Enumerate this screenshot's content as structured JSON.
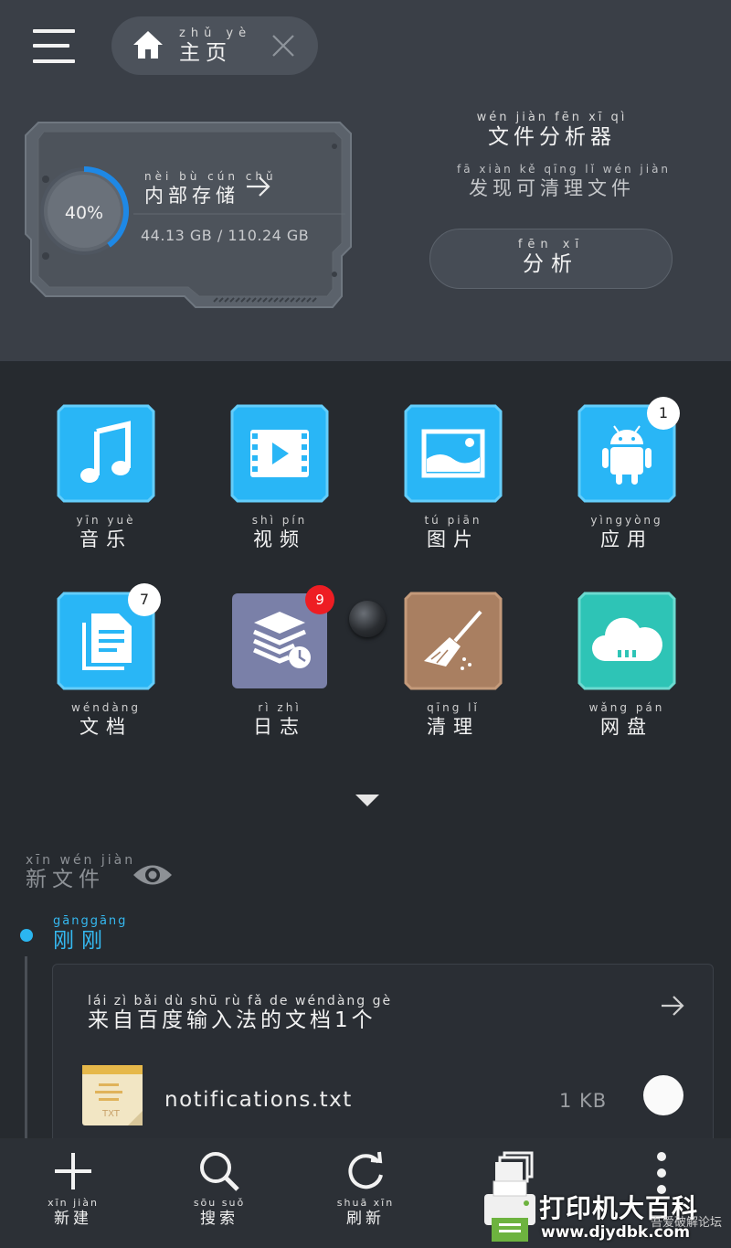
{
  "header": {
    "home_tab": {
      "pinyin": "zhǔ yè",
      "label": "主页"
    }
  },
  "storage": {
    "percent_text": "40%",
    "used_fraction": 0.4,
    "title_pinyin": "nèi bù cún chǔ",
    "title": "内部存储",
    "size_text": "44.13 GB / 110.24 GB"
  },
  "analyzer": {
    "title_pinyin": "wén jiàn fēn xī qì",
    "title": "文件分析器",
    "subtitle_pinyin": "fā xiàn kě qīng lǐ wén jiàn",
    "subtitle": "发现可清理文件",
    "button_pinyin": "fēn xī",
    "button_label": "分析"
  },
  "categories": [
    {
      "pinyin": "yīn yuè",
      "label": "音乐",
      "icon": "music-icon"
    },
    {
      "pinyin": "shì pín",
      "label": "视频",
      "icon": "video-icon"
    },
    {
      "pinyin": "tú piān",
      "label": "图片",
      "icon": "image-icon"
    },
    {
      "pinyin": "yìngyòng",
      "label": "应用",
      "icon": "android-icon",
      "badge": "1"
    },
    {
      "pinyin": "wéndàng",
      "label": "文档",
      "icon": "document-icon",
      "badge": "7"
    },
    {
      "pinyin": "rì zhì",
      "label": "日志",
      "icon": "log-icon",
      "badge": "9"
    },
    {
      "pinyin": "qīng lǐ",
      "label": "清理",
      "icon": "broom-icon"
    },
    {
      "pinyin": "wǎng pán",
      "label": "网盘",
      "icon": "cloud-icon"
    }
  ],
  "new_files": {
    "pinyin": "xīn wén jiàn",
    "label": "新文件",
    "timeline_pinyin": "gānggāng",
    "timeline_label": "刚刚",
    "group_pinyin": "lái zì bǎi dù shū rù fǎ de wéndàng gè",
    "group_title": "来自百度输入法的文档1个",
    "files": [
      {
        "name": "notifications.txt",
        "size": "1 KB",
        "icon_text": "TXT"
      }
    ]
  },
  "bottom_bar": [
    {
      "pinyin": "xīn jiàn",
      "label": "新建",
      "icon": "plus-icon"
    },
    {
      "pinyin": "sōu suǒ",
      "label": "搜索",
      "icon": "search-icon"
    },
    {
      "pinyin": "shuā xīn",
      "label": "刷新",
      "icon": "refresh-icon"
    },
    {
      "pinyin": "",
      "label": "",
      "icon": "windows-icon"
    },
    {
      "pinyin": "",
      "label": "",
      "icon": "more-icon"
    }
  ],
  "watermark": {
    "title": "打印机大百科",
    "url": "www.djydbk.com",
    "small": "吾爱破解论坛"
  },
  "colors": {
    "accent_blue": "#29b6f6",
    "badge_red": "#ee1d23",
    "header_bg": "#3a3f47",
    "body_bg": "#262a2f"
  }
}
